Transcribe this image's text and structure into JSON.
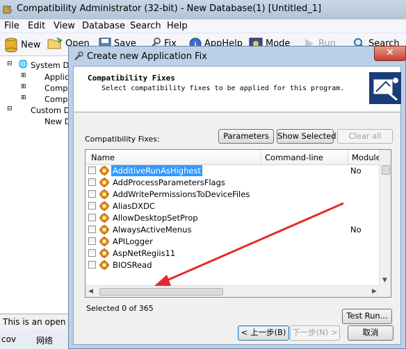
{
  "main": {
    "title": "Compatibility Administrator (32-bit) - New Database(1) [Untitled_1]",
    "menu": [
      "File",
      "Edit",
      "View",
      "Database",
      "Search",
      "Help"
    ],
    "toolbar": {
      "new": "New",
      "open": "Open",
      "save": "Save",
      "fix": "Fix",
      "apphelp": "AppHelp",
      "mode": "Mode",
      "run": "Run",
      "search": "Search"
    },
    "tree": {
      "system_db": "System Da",
      "applications": "Applica",
      "compat1": "Compa",
      "compat2": "Compa",
      "custom_db": "Custom Da",
      "new_db": "New D"
    },
    "status": "This is an open",
    "taskbar": {
      "left": "cov",
      "network": "网络"
    }
  },
  "dialog": {
    "title": "Create new Application Fix",
    "close": "✕",
    "header_title": "Compatibility Fixes",
    "header_subtitle": "Select compatibility fixes to be applied for this program.",
    "list_label": "Compatibility Fixes:",
    "buttons": {
      "parameters": "Parameters",
      "show_selected": "Show Selected",
      "clear_all": "Clear all",
      "test_run": "Test Run...",
      "back": "< 上一步(B)",
      "next": "下一步(N) >",
      "cancel": "取消"
    },
    "columns": [
      "Name",
      "Command-line",
      "Module"
    ],
    "fixes": [
      {
        "name": "AdditiveRunAsHighest",
        "module": "No",
        "selected": true
      },
      {
        "name": "AddProcessParametersFlags",
        "module": "",
        "selected": false
      },
      {
        "name": "AddWritePermissionsToDeviceFiles",
        "module": "",
        "selected": false
      },
      {
        "name": "AliasDXDC",
        "module": "",
        "selected": false
      },
      {
        "name": "AllowDesktopSetProp",
        "module": "",
        "selected": false
      },
      {
        "name": "AlwaysActiveMenus",
        "module": "No",
        "selected": false
      },
      {
        "name": "APILogger",
        "module": "",
        "selected": false
      },
      {
        "name": "AspNetRegiis11",
        "module": "",
        "selected": false
      },
      {
        "name": "BIOSRead",
        "module": "",
        "selected": false
      }
    ],
    "selected_count": "Selected 0 of 365"
  },
  "annotation": {
    "arrow_color": "#e32b2b"
  }
}
